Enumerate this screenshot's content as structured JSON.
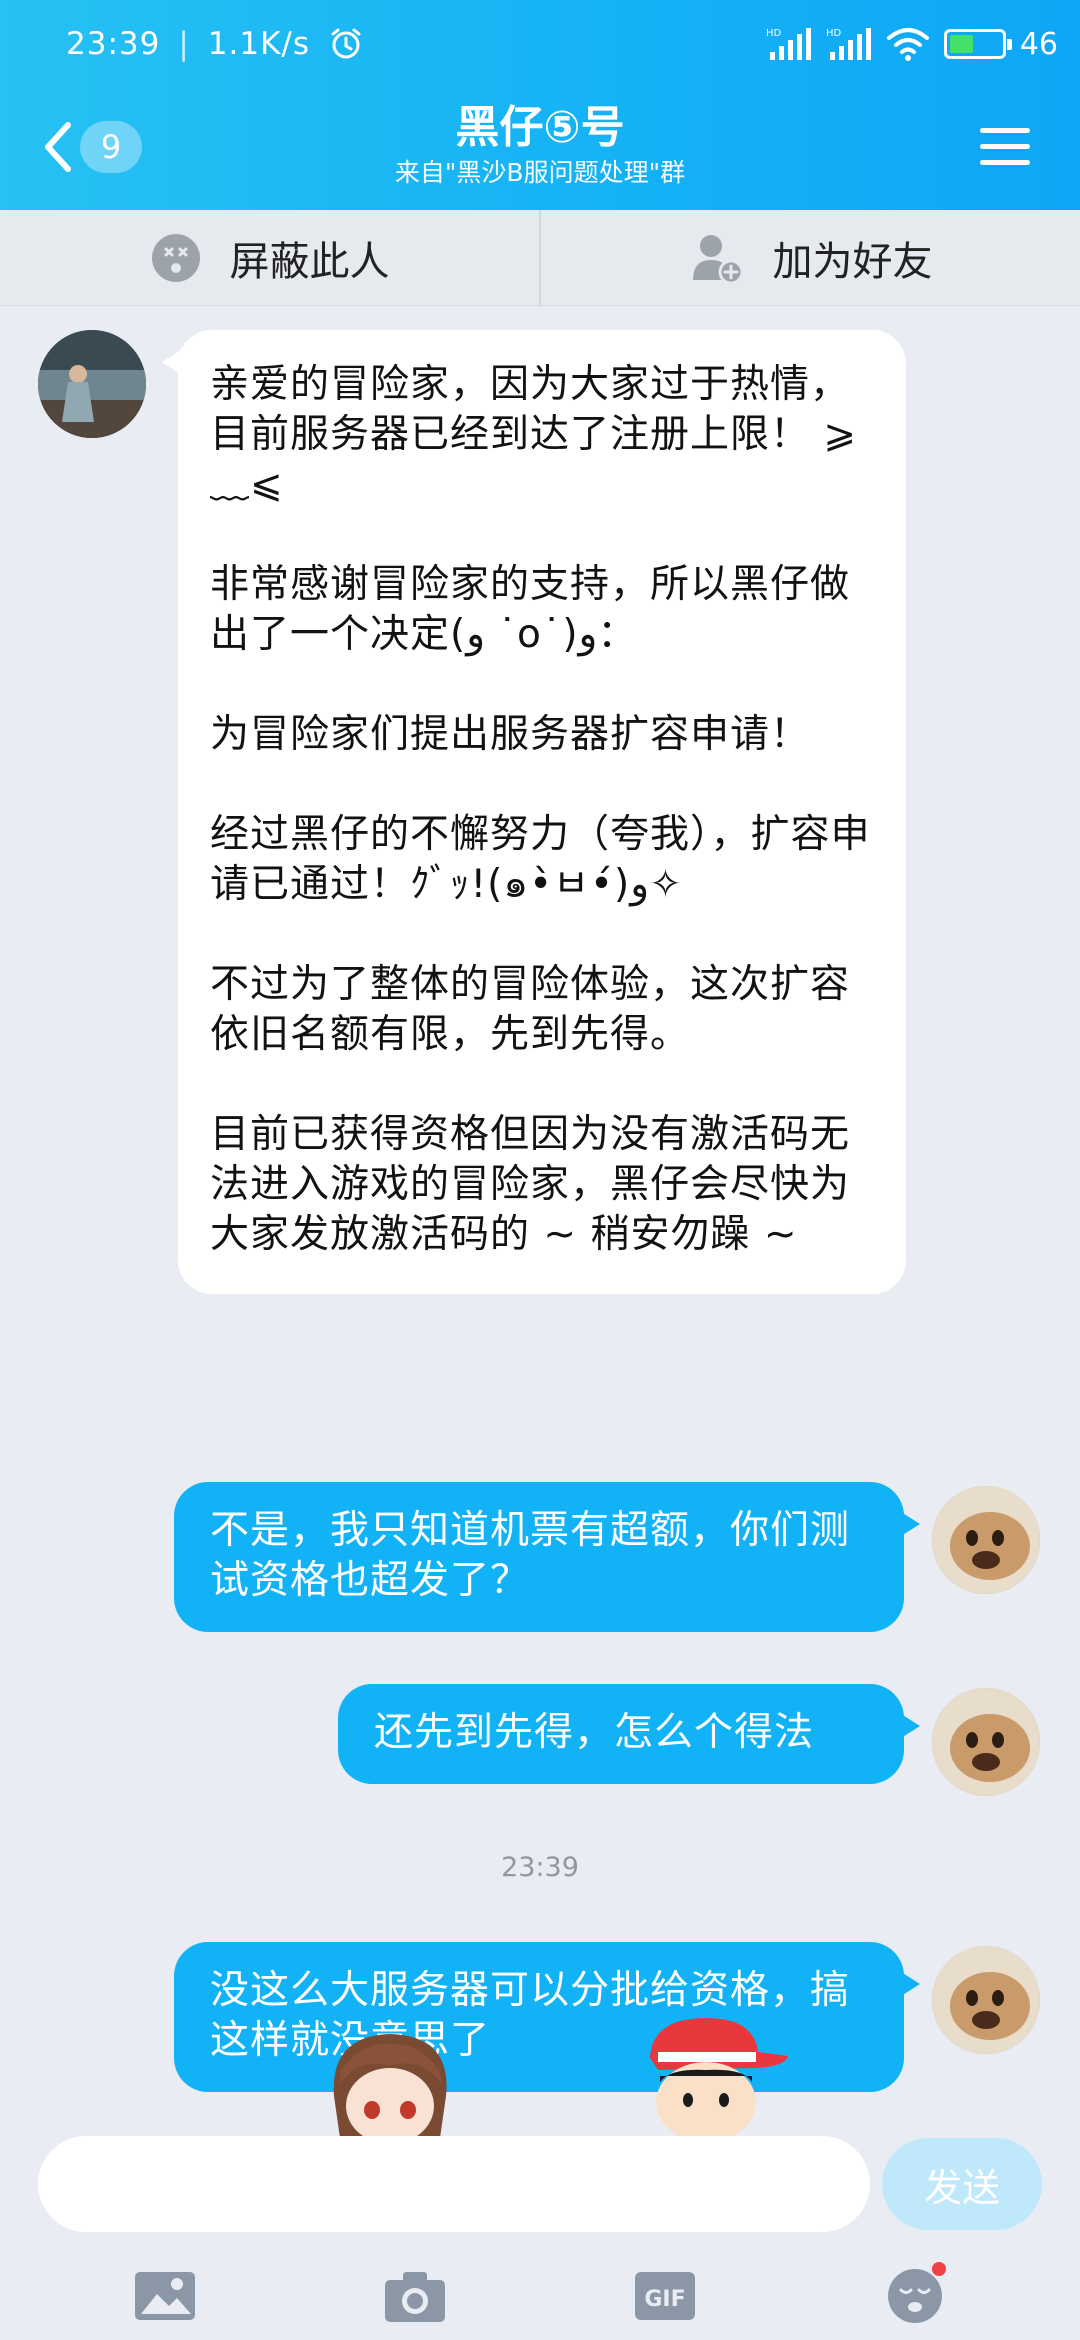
{
  "status_bar": {
    "time": "23:39",
    "speed": "1.1K/s",
    "signal1": "HD",
    "signal2": "HD",
    "battery": "46"
  },
  "header": {
    "back_count": "9",
    "title": "黑仔⑤号",
    "subtitle": "来自\"黑沙B服问题处理\"群"
  },
  "actions": {
    "block": "屏蔽此人",
    "add_friend": "加为好友"
  },
  "messages": [
    {
      "side": "in",
      "text": "亲爱的冒险家，因为大家过于热情，目前服务器已经到达了注册上限！ ⩾﹏⩽\n\n非常感谢冒险家的支持，所以黑仔做出了一个决定(و ˙o˙)و：\n\n为冒险家们提出服务器扩容申请！\n\n经过黑仔的不懈努力（夸我），扩容申请已通过！ｸﾞｯ!(๑•̀ㅂ•́)و✧\n\n不过为了整体的冒险体验，这次扩容依旧名额有限，先到先得。\n\n目前已获得资格但因为没有激活码无法进入游戏的冒险家，黑仔会尽快为大家发放激活码的 ~ 稍安勿躁 ~"
    },
    {
      "side": "out",
      "text": "不是，我只知道机票有超额，你们测试资格也超发了？"
    },
    {
      "side": "out",
      "text": "还先到先得，怎么个得法"
    },
    {
      "side": "out",
      "text": "没这么大服务器可以分批给资格，搞这样就没意思了"
    }
  ],
  "timestamp": "23:39",
  "input": {
    "placeholder": "",
    "send_label": "发送"
  },
  "toolbar": {
    "image": "image-icon",
    "camera": "camera-icon",
    "gif": "GIF",
    "emoji": "emoji-icon"
  },
  "colors": {
    "header": "#16b3f5",
    "bubble_out": "#12b2f7",
    "background": "#e9edf3",
    "send_disabled": "#bfe8fb"
  }
}
